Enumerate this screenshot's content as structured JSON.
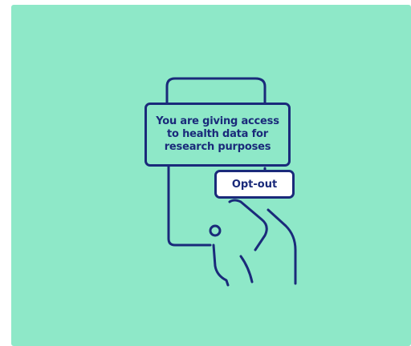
{
  "notice": {
    "message": "You are giving access to health data for research purposes"
  },
  "actions": {
    "opt_out_label": "Opt-out"
  },
  "illustration": {
    "icon": "hand-holding-phone-icon"
  },
  "colors": {
    "background": "#8ee8c8",
    "outline": "#1a2a7a",
    "button_fill": "#ffffff"
  }
}
